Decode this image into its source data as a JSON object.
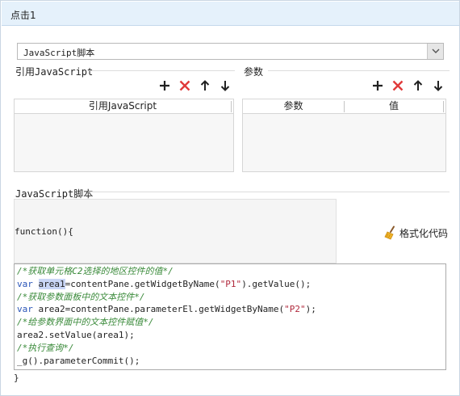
{
  "window": {
    "title": "点击1"
  },
  "script_type": {
    "selected": "JavaScript脚本"
  },
  "ref_section": {
    "label": "引用JavaScript",
    "table_headers": [
      "引用JavaScript"
    ]
  },
  "param_section": {
    "label": "参数",
    "table_headers": [
      "参数",
      "值"
    ]
  },
  "toolbar": {
    "add": "add-icon",
    "delete": "delete-icon",
    "up": "arrow-up-icon",
    "down": "arrow-down-icon"
  },
  "script_section": {
    "label": "JavaScript脚本",
    "function_open": "function(){",
    "format_button": "格式化代码",
    "function_close": "}"
  },
  "code_lines": [
    "/*获取单元格C2选择的地区控件的值*/",
    "var area1=contentPane.getWidgetByName(\"P1\").getValue();",
    "/*获取参数面板中的文本控件*/",
    "var area2=contentPane.parameterEl.getWidgetByName(\"P2\");",
    "/*给参数界面中的文本控件赋值*/",
    "area2.setValue(area1);",
    "/*执行查询*/",
    "_g().parameterCommit();"
  ],
  "colors": {
    "titlebar_bg": "#e5f1fb",
    "delete_red": "#e03a3a",
    "comment": "#3a8a3a",
    "keyword": "#2a55b8",
    "string": "#b0293c"
  }
}
